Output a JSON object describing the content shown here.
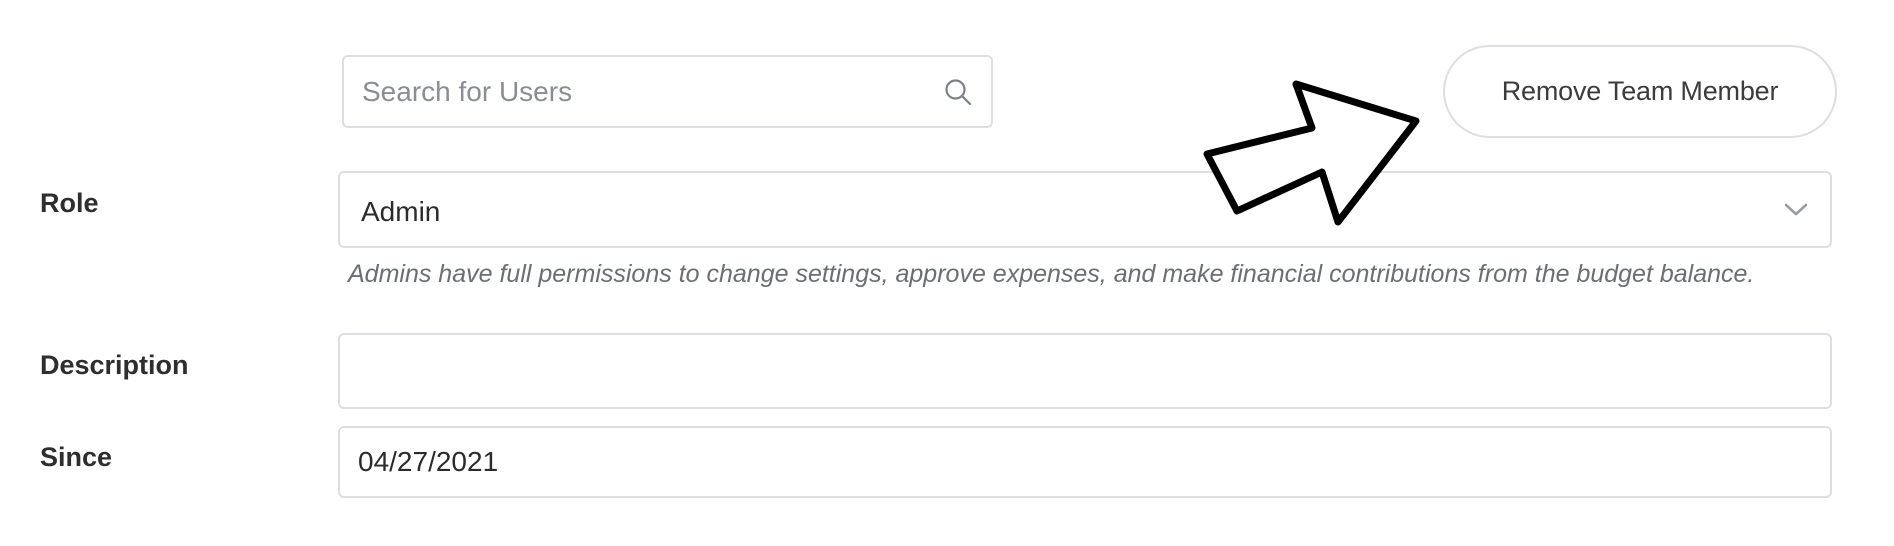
{
  "search": {
    "placeholder": "Search for Users",
    "value": "",
    "icon": "search-icon"
  },
  "actions": {
    "remove_label": "Remove Team Member"
  },
  "fields": {
    "role": {
      "label": "Role",
      "value": "Admin",
      "help": "Admins have full permissions to change settings, approve expenses, and make financial contributions from the budget balance.",
      "icon": "chevron-down-icon"
    },
    "description": {
      "label": "Description",
      "value": ""
    },
    "since": {
      "label": "Since",
      "value": "04/27/2021"
    }
  },
  "annotation": {
    "icon": "pointer-arrow-icon",
    "color": "#000000"
  },
  "colors": {
    "border": "#dcdee2",
    "help_text": "#6b6e74",
    "label_text": "#2e2e2e"
  }
}
